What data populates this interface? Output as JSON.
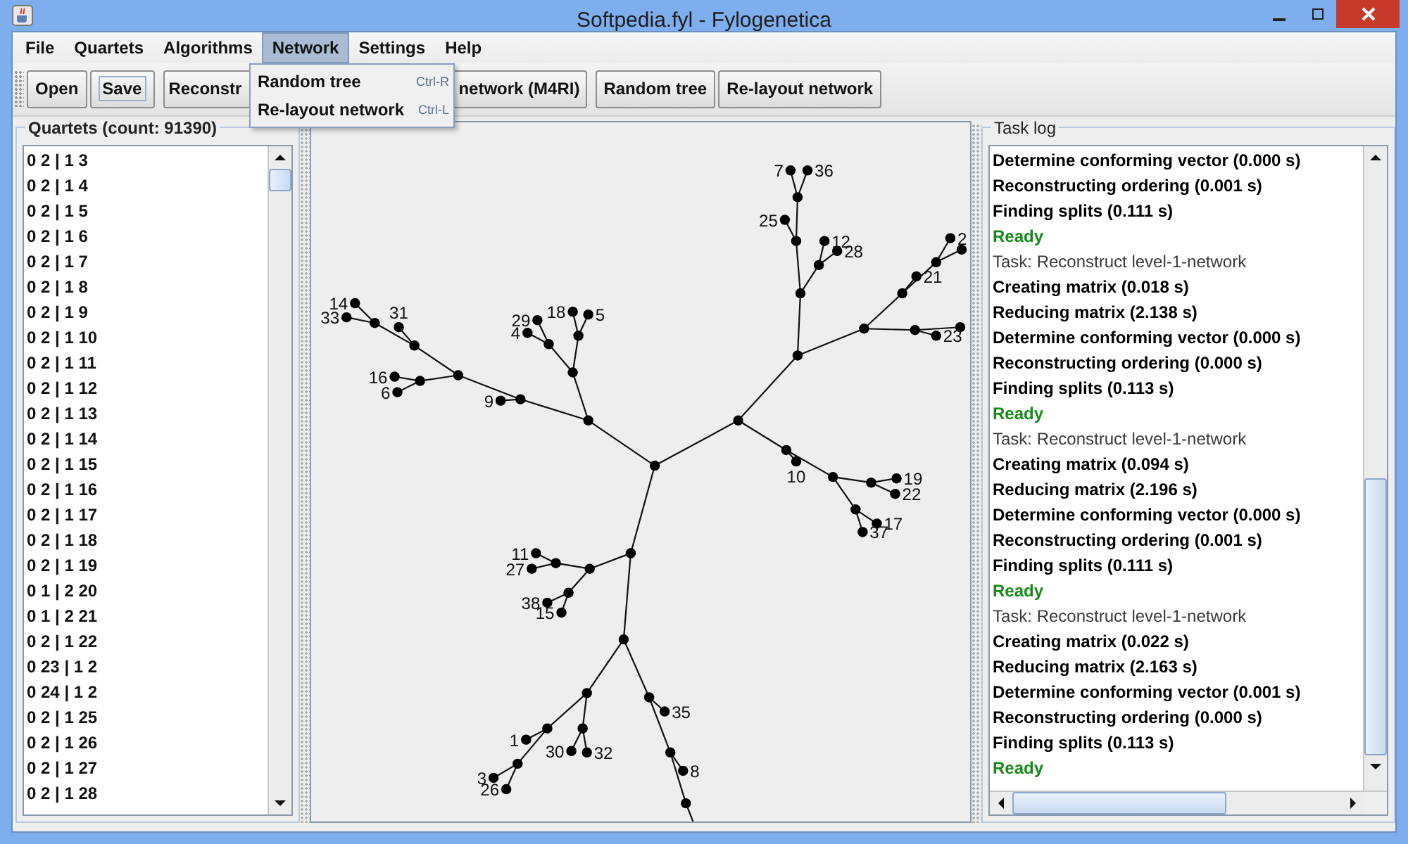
{
  "window": {
    "title": "Softpedia.fyl - Fylogenetica"
  },
  "menu": [
    {
      "label": "File",
      "selected": false
    },
    {
      "label": "Quartets",
      "selected": false
    },
    {
      "label": "Algorithms",
      "selected": false
    },
    {
      "label": "Network",
      "selected": true
    },
    {
      "label": "Settings",
      "selected": false
    },
    {
      "label": "Help",
      "selected": false
    }
  ],
  "dropdown": [
    {
      "label": "Random tree",
      "shortcut": "Ctrl-R"
    },
    {
      "label": "Re-layout network",
      "shortcut": "Ctrl-L"
    }
  ],
  "toolbar": [
    {
      "label": "Open",
      "focused": false
    },
    {
      "label": "Save",
      "focused": true
    },
    {
      "label": "Reconstr",
      "focused": false
    },
    {
      "label": "network (M4RI)",
      "focused": false
    },
    {
      "label": "Random tree",
      "focused": false
    },
    {
      "label": "Re-layout network",
      "focused": false
    }
  ],
  "quartets": {
    "title": "Quartets (count: 91390)",
    "items": [
      "0 2 | 1 3",
      "0 2 | 1 4",
      "0 2 | 1 5",
      "0 2 | 1 6",
      "0 2 | 1 7",
      "0 2 | 1 8",
      "0 2 | 1 9",
      "0 2 | 1 10",
      "0 2 | 1 11",
      "0 2 | 1 12",
      "0 2 | 1 13",
      "0 2 | 1 14",
      "0 2 | 1 15",
      "0 2 | 1 16",
      "0 2 | 1 17",
      "0 2 | 1 18",
      "0 2 | 1 19",
      "0 1 | 2 20",
      "0 1 | 2 21",
      "0 2 | 1 22",
      "0 23 | 1 2",
      "0 24 | 1 2",
      "0 2 | 1 25",
      "0 2 | 1 26",
      "0 2 | 1 27",
      "0 2 | 1 28"
    ]
  },
  "network": {
    "leaves": [
      "9",
      "14",
      "33",
      "31",
      "16",
      "6",
      "29",
      "4",
      "18",
      "5",
      "25",
      "7",
      "36",
      "12",
      "28",
      "21",
      "2",
      "23",
      "10",
      "19",
      "22",
      "17",
      "37",
      "11",
      "27",
      "38",
      "15",
      "1",
      "3",
      "26",
      "30",
      "32",
      "35",
      "8"
    ]
  },
  "task_log": {
    "title": "Task log",
    "lines": [
      {
        "kind": "step",
        "text": "Determine conforming vector (0.000 s)"
      },
      {
        "kind": "step",
        "text": "Reconstructing ordering (0.001 s)"
      },
      {
        "kind": "step",
        "text": "Finding splits (0.111 s)"
      },
      {
        "kind": "ready",
        "text": "Ready"
      },
      {
        "kind": "task",
        "text": "Task: Reconstruct level-1-network"
      },
      {
        "kind": "step",
        "text": "Creating matrix (0.018 s)"
      },
      {
        "kind": "step",
        "text": "Reducing matrix (2.138 s)"
      },
      {
        "kind": "step",
        "text": "Determine conforming vector (0.000 s)"
      },
      {
        "kind": "step",
        "text": "Reconstructing ordering (0.000 s)"
      },
      {
        "kind": "step",
        "text": "Finding splits (0.113 s)"
      },
      {
        "kind": "ready",
        "text": "Ready"
      },
      {
        "kind": "task",
        "text": "Task: Reconstruct level-1-network"
      },
      {
        "kind": "step",
        "text": "Creating matrix (0.094 s)"
      },
      {
        "kind": "step",
        "text": "Reducing matrix (2.196 s)"
      },
      {
        "kind": "step",
        "text": "Determine conforming vector (0.000 s)"
      },
      {
        "kind": "step",
        "text": "Reconstructing ordering (0.001 s)"
      },
      {
        "kind": "step",
        "text": "Finding splits (0.111 s)"
      },
      {
        "kind": "ready",
        "text": "Ready"
      },
      {
        "kind": "task",
        "text": "Task: Reconstruct level-1-network"
      },
      {
        "kind": "step",
        "text": "Creating matrix (0.022 s)"
      },
      {
        "kind": "step",
        "text": "Reducing matrix (2.163 s)"
      },
      {
        "kind": "step",
        "text": "Determine conforming vector (0.001 s)"
      },
      {
        "kind": "step",
        "text": "Reconstructing ordering (0.000 s)"
      },
      {
        "kind": "step",
        "text": "Finding splits (0.113 s)"
      },
      {
        "kind": "ready",
        "text": "Ready"
      }
    ]
  }
}
